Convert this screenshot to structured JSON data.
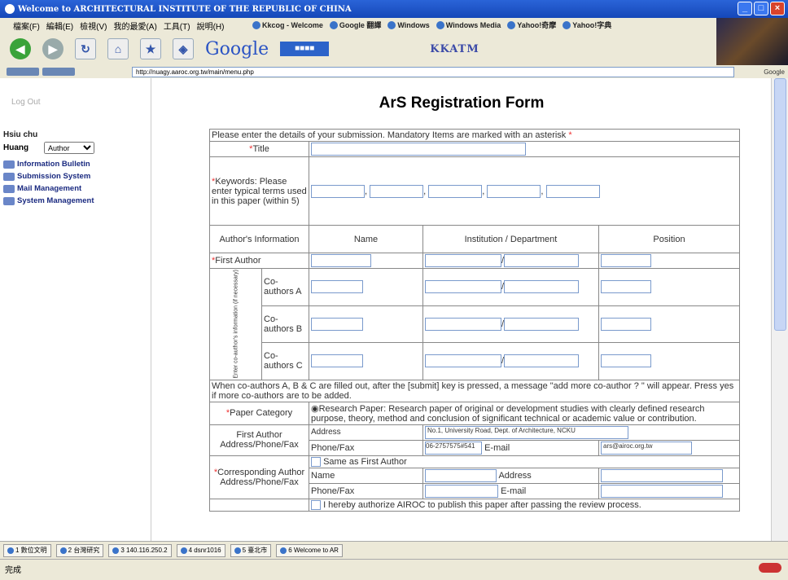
{
  "window": {
    "title": "Welcome to ARCHITECTURAL INSTITUTE OF THE REPUBLIC OF CHINA"
  },
  "browser": {
    "menu": [
      "檔案(F)",
      "編輯(E)",
      "檢視(V)",
      "我的最愛(A)",
      "工具(T)",
      "說明(H)"
    ],
    "links": [
      "Kkcog - Welcome",
      "Google 翻譯",
      "Windows",
      "Windows Media",
      "Yahoo!奇摩",
      "Yahoo!字典"
    ],
    "google": "Google",
    "kkatm": "KKATM",
    "url": "http://nuagy.aaroc.org.tw/main/menu.php",
    "google_text": "Google"
  },
  "sidebar": {
    "logout": "Log Out",
    "user": "Hsiu chu",
    "user2": "Huang",
    "role": "Author",
    "items": [
      "Information Bulletin",
      "Submission System",
      "Mail Management",
      "System Management"
    ]
  },
  "form": {
    "title": "ArS Registration Form",
    "intro": "Please enter the details of your submission. Mandatory Items are marked with an asterisk",
    "title_label": "Title",
    "keywords_label": "Keywords: Please enter typical terms used in this paper (within 5)",
    "author_info": "Author's Information",
    "col_name": "Name",
    "col_inst": "Institution / Department",
    "col_pos": "Position",
    "first_author": "First Author",
    "vertical_label": "Enter co-author's information (if necessary)",
    "coauthors": [
      "Co-authors A",
      "Co-authors B",
      "Co-authors C"
    ],
    "coauthor_note": "When co-authors A, B & C are filled out, after the [submit] key is pressed, a message \"add more co-author ? \" will appear. Press yes if more co-authors are to be added.",
    "paper_cat_label": "Paper Category",
    "paper_cat_text": "Research Paper: Research paper of original or development studies with clearly defined research purpose, theory, method and conclusion of significant technical or academic value or contribution.",
    "first_author_addr": "First Author Address/Phone/Fax",
    "addr_label": "Address",
    "addr_value": "No.1, University Road, Dept. of Architecture, NCKU",
    "phone_label": "Phone/Fax",
    "phone_value": "06-2757575#541",
    "email_label": "E-mail",
    "email_value": "ars@airoc.org.tw",
    "corr_label": "Corresponding Author Address/Phone/Fax",
    "same_as": "Same as First Author",
    "name_label": "Name",
    "authorize": "I hereby authorize AIROC to publish this paper after passing the review process."
  },
  "taskbar": [
    "1 數位文明",
    "2 台灣研究",
    "3 140.116.250.2",
    "4 dsnr1016",
    "5 臺北市",
    "6 Welcome to AR"
  ],
  "status": "完成"
}
